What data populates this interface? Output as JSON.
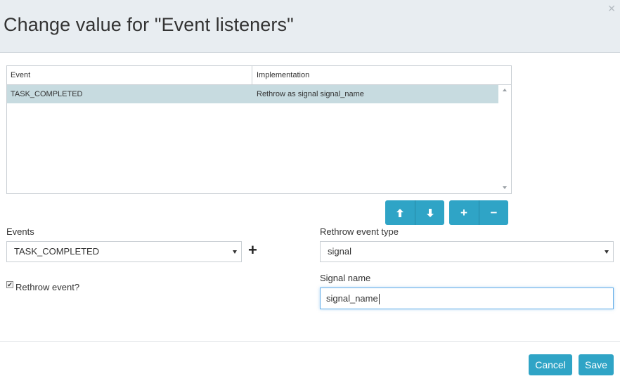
{
  "dialog": {
    "title": "Change value for \"Event listeners\"",
    "close_icon": "close-icon"
  },
  "grid": {
    "columns": [
      "Event",
      "Implementation"
    ],
    "rows": [
      {
        "event": "TASK_COMPLETED",
        "implementation": "Rethrow as signal signal_name",
        "selected": true
      }
    ]
  },
  "toolbar": {
    "move_up_icon": "arrow-up-icon",
    "move_down_icon": "arrow-down-icon",
    "add_icon": "plus-icon",
    "remove_icon": "minus-icon",
    "move_up_glyph": "🡅",
    "move_down_glyph": "🡇",
    "add_glyph": "+",
    "remove_glyph": "−"
  },
  "form": {
    "events_label": "Events",
    "events_value": "TASK_COMPLETED",
    "add_event_glyph": "+",
    "rethrow_checkbox_label": "Rethrow event?",
    "rethrow_checked": true,
    "rethrow_type_label": "Rethrow event type",
    "rethrow_type_value": "signal",
    "signal_name_label": "Signal name",
    "signal_name_value": "signal_name"
  },
  "footer": {
    "cancel_label": "Cancel",
    "save_label": "Save"
  },
  "colors": {
    "header_bg": "#e8edf1",
    "accent": "#2fa4c6",
    "selected_row": "#c7dbe0"
  }
}
